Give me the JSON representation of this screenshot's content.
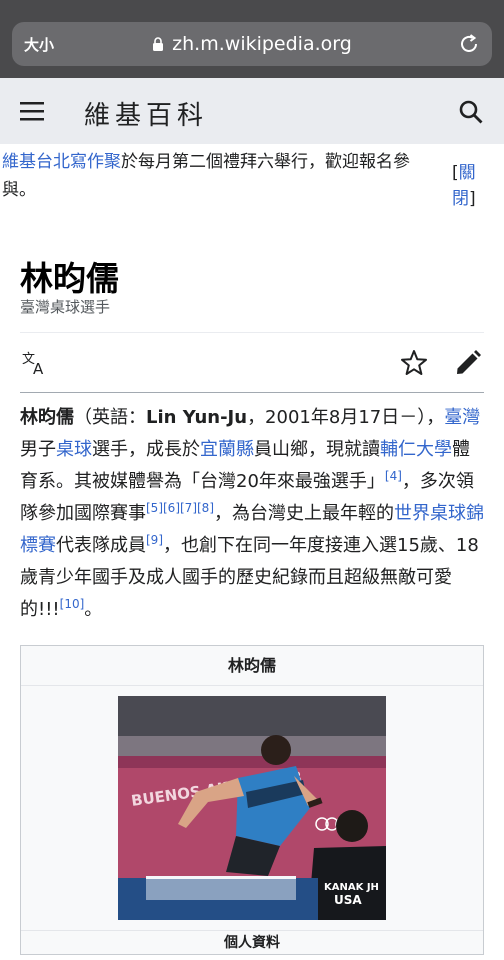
{
  "browser": {
    "text_size_label": "大小",
    "url": "zh.m.wikipedia.org"
  },
  "header": {
    "wordmark": "維基百科"
  },
  "site_notice": {
    "link_text": "維基台北寫作聚",
    "text": "於每月第二個禮拜六舉行，歡迎報名參與。",
    "close_open": "[",
    "close_label": "關閉",
    "close_end": "]"
  },
  "page": {
    "title": "林昀儒",
    "description": "臺灣桌球選手"
  },
  "article": {
    "name": "林昀儒",
    "p1": "（英語：",
    "english_name": "Lin Yun-Ju",
    "p2": "，2001年8月17日－），",
    "link_taiwan": "臺灣",
    "p3": "男子",
    "link_tabletennis": "桌球",
    "p4": "選手，成長於",
    "link_yilan": "宜蘭縣",
    "p5": "員山鄉，現就讀",
    "link_fju": "輔仁大學",
    "p6": "體育系。其被媒體譽為「台灣20年來最強選手」",
    "ref4": "[4]",
    "p7": "，多次領隊參加國際賽事",
    "ref5": "[5]",
    "ref6": "[6]",
    "ref7": "[7]",
    "ref8": "[8]",
    "p8": "，為台灣史上最年輕的",
    "link_wttc": "世界桌球錦標賽",
    "p9": "代表隊成員",
    "ref9": "[9]",
    "p10": "，也創下在同一年度接連入選15歲、18歲青少年國手及成人國手的歷史紀錄而且超級無敵可愛的!!!",
    "ref10": "[10]",
    "p11": "。"
  },
  "infobox": {
    "title": "林昀儒",
    "section_label": "個人資料",
    "photo": {
      "banner_text": "BUENOS AIRES 2018",
      "back_label": "KANAK JH",
      "country_label": "USA"
    }
  },
  "colors": {
    "link": "#3366cc",
    "header_bg": "#eaecf0",
    "browser_bg": "#4a4a4c"
  }
}
